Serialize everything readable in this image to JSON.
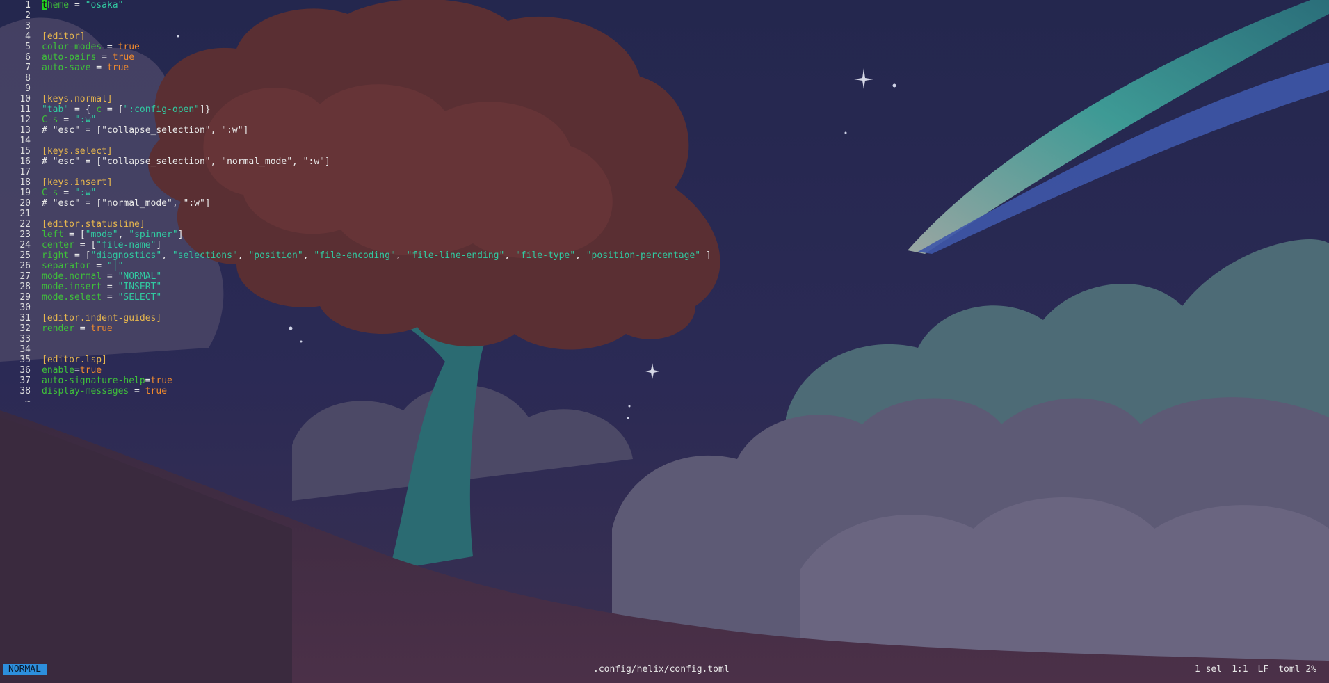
{
  "editor": {
    "lines": [
      {
        "n": "1",
        "tokens": [
          {
            "t": "t",
            "c": "cursor"
          },
          {
            "t": "heme",
            "c": "key"
          },
          {
            "t": " = ",
            "c": "plain"
          },
          {
            "t": "\"osaka\"",
            "c": "str"
          }
        ]
      },
      {
        "n": "2",
        "tokens": []
      },
      {
        "n": "3",
        "tokens": []
      },
      {
        "n": "4",
        "tokens": [
          {
            "t": "[editor]",
            "c": "sec"
          }
        ]
      },
      {
        "n": "5",
        "tokens": [
          {
            "t": "color-modes",
            "c": "key"
          },
          {
            "t": " = ",
            "c": "plain"
          },
          {
            "t": "true",
            "c": "bool"
          }
        ]
      },
      {
        "n": "6",
        "tokens": [
          {
            "t": "auto-pairs",
            "c": "key"
          },
          {
            "t": " = ",
            "c": "plain"
          },
          {
            "t": "true",
            "c": "bool"
          }
        ]
      },
      {
        "n": "7",
        "tokens": [
          {
            "t": "auto-save",
            "c": "key"
          },
          {
            "t": " = ",
            "c": "plain"
          },
          {
            "t": "true",
            "c": "bool"
          }
        ]
      },
      {
        "n": "8",
        "tokens": []
      },
      {
        "n": "9",
        "tokens": []
      },
      {
        "n": "10",
        "tokens": [
          {
            "t": "[keys.normal]",
            "c": "sec"
          }
        ]
      },
      {
        "n": "11",
        "tokens": [
          {
            "t": "\"tab\"",
            "c": "str"
          },
          {
            "t": " = { ",
            "c": "plain"
          },
          {
            "t": "c",
            "c": "key"
          },
          {
            "t": " = [",
            "c": "plain"
          },
          {
            "t": "\":config-open\"",
            "c": "str"
          },
          {
            "t": "]}",
            "c": "plain"
          }
        ]
      },
      {
        "n": "12",
        "tokens": [
          {
            "t": "C-s",
            "c": "key"
          },
          {
            "t": " = ",
            "c": "plain"
          },
          {
            "t": "\":w\"",
            "c": "str"
          }
        ]
      },
      {
        "n": "13",
        "tokens": [
          {
            "t": "# \"esc\" = [\"collapse_selection\", \":w\"]",
            "c": "plain"
          }
        ]
      },
      {
        "n": "14",
        "tokens": []
      },
      {
        "n": "15",
        "tokens": [
          {
            "t": "[keys.select]",
            "c": "sec"
          }
        ]
      },
      {
        "n": "16",
        "tokens": [
          {
            "t": "# \"esc\" = [\"collapse_selection\", \"normal_mode\", \":w\"]",
            "c": "plain"
          }
        ]
      },
      {
        "n": "17",
        "tokens": []
      },
      {
        "n": "18",
        "tokens": [
          {
            "t": "[keys.insert]",
            "c": "sec"
          }
        ]
      },
      {
        "n": "19",
        "tokens": [
          {
            "t": "C-s",
            "c": "key"
          },
          {
            "t": " = ",
            "c": "plain"
          },
          {
            "t": "\":w\"",
            "c": "str"
          }
        ]
      },
      {
        "n": "20",
        "tokens": [
          {
            "t": "# \"esc\" = [\"normal_mode\", \":w\"]",
            "c": "plain"
          }
        ]
      },
      {
        "n": "21",
        "tokens": []
      },
      {
        "n": "22",
        "tokens": [
          {
            "t": "[editor.statusline]",
            "c": "sec"
          }
        ]
      },
      {
        "n": "23",
        "tokens": [
          {
            "t": "left",
            "c": "key"
          },
          {
            "t": " = [",
            "c": "plain"
          },
          {
            "t": "\"mode\"",
            "c": "str"
          },
          {
            "t": ", ",
            "c": "plain"
          },
          {
            "t": "\"spinner\"",
            "c": "str"
          },
          {
            "t": "]",
            "c": "plain"
          }
        ]
      },
      {
        "n": "24",
        "tokens": [
          {
            "t": "center",
            "c": "key"
          },
          {
            "t": " = [",
            "c": "plain"
          },
          {
            "t": "\"file-name\"",
            "c": "str"
          },
          {
            "t": "]",
            "c": "plain"
          }
        ]
      },
      {
        "n": "25",
        "tokens": [
          {
            "t": "right",
            "c": "key"
          },
          {
            "t": " = [",
            "c": "plain"
          },
          {
            "t": "\"diagnostics\"",
            "c": "str"
          },
          {
            "t": ", ",
            "c": "plain"
          },
          {
            "t": "\"selections\"",
            "c": "str"
          },
          {
            "t": ", ",
            "c": "plain"
          },
          {
            "t": "\"position\"",
            "c": "str"
          },
          {
            "t": ", ",
            "c": "plain"
          },
          {
            "t": "\"file-encoding\"",
            "c": "str"
          },
          {
            "t": ", ",
            "c": "plain"
          },
          {
            "t": "\"file-line-ending\"",
            "c": "str"
          },
          {
            "t": ", ",
            "c": "plain"
          },
          {
            "t": "\"file-type\"",
            "c": "str"
          },
          {
            "t": ", ",
            "c": "plain"
          },
          {
            "t": "\"position-percentage\"",
            "c": "str"
          },
          {
            "t": " ]",
            "c": "plain"
          }
        ]
      },
      {
        "n": "26",
        "tokens": [
          {
            "t": "separator",
            "c": "key"
          },
          {
            "t": " = ",
            "c": "plain"
          },
          {
            "t": "\"│\"",
            "c": "str"
          }
        ]
      },
      {
        "n": "27",
        "tokens": [
          {
            "t": "mode.normal",
            "c": "key"
          },
          {
            "t": " = ",
            "c": "plain"
          },
          {
            "t": "\"NORMAL\"",
            "c": "str"
          }
        ]
      },
      {
        "n": "28",
        "tokens": [
          {
            "t": "mode.insert",
            "c": "key"
          },
          {
            "t": " = ",
            "c": "plain"
          },
          {
            "t": "\"INSERT\"",
            "c": "str"
          }
        ]
      },
      {
        "n": "29",
        "tokens": [
          {
            "t": "mode.select",
            "c": "key"
          },
          {
            "t": " = ",
            "c": "plain"
          },
          {
            "t": "\"SELECT\"",
            "c": "str"
          }
        ]
      },
      {
        "n": "30",
        "tokens": []
      },
      {
        "n": "31",
        "tokens": [
          {
            "t": "[editor.indent-guides]",
            "c": "sec"
          }
        ]
      },
      {
        "n": "32",
        "tokens": [
          {
            "t": "render",
            "c": "key"
          },
          {
            "t": " = ",
            "c": "plain"
          },
          {
            "t": "true",
            "c": "bool"
          }
        ]
      },
      {
        "n": "33",
        "tokens": []
      },
      {
        "n": "34",
        "tokens": []
      },
      {
        "n": "35",
        "tokens": [
          {
            "t": "[editor.lsp]",
            "c": "sec"
          }
        ]
      },
      {
        "n": "36",
        "tokens": [
          {
            "t": "enable",
            "c": "key"
          },
          {
            "t": "=",
            "c": "plain"
          },
          {
            "t": "true",
            "c": "bool"
          }
        ]
      },
      {
        "n": "37",
        "tokens": [
          {
            "t": "auto-signature-help",
            "c": "key"
          },
          {
            "t": "=",
            "c": "plain"
          },
          {
            "t": "true",
            "c": "bool"
          }
        ]
      },
      {
        "n": "38",
        "tokens": [
          {
            "t": "display-messages",
            "c": "key"
          },
          {
            "t": " = ",
            "c": "plain"
          },
          {
            "t": "true",
            "c": "bool"
          }
        ]
      }
    ],
    "tilde": "~"
  },
  "statusline": {
    "mode": "NORMAL",
    "filename": ".config/helix/config.toml",
    "selections": "1 sel",
    "position": "1:1",
    "line_ending": "LF",
    "file_type": "toml",
    "position_percentage": "2%"
  },
  "colors": {
    "key": "#3fbf3a",
    "string": "#31c9a0",
    "boolean": "#f08a2e",
    "section": "#e6b64e",
    "mode_bg": "#2d8fdd",
    "cursor": "#22d022"
  },
  "wallpaper_icon": "tree-comet-clouds-wallpaper"
}
